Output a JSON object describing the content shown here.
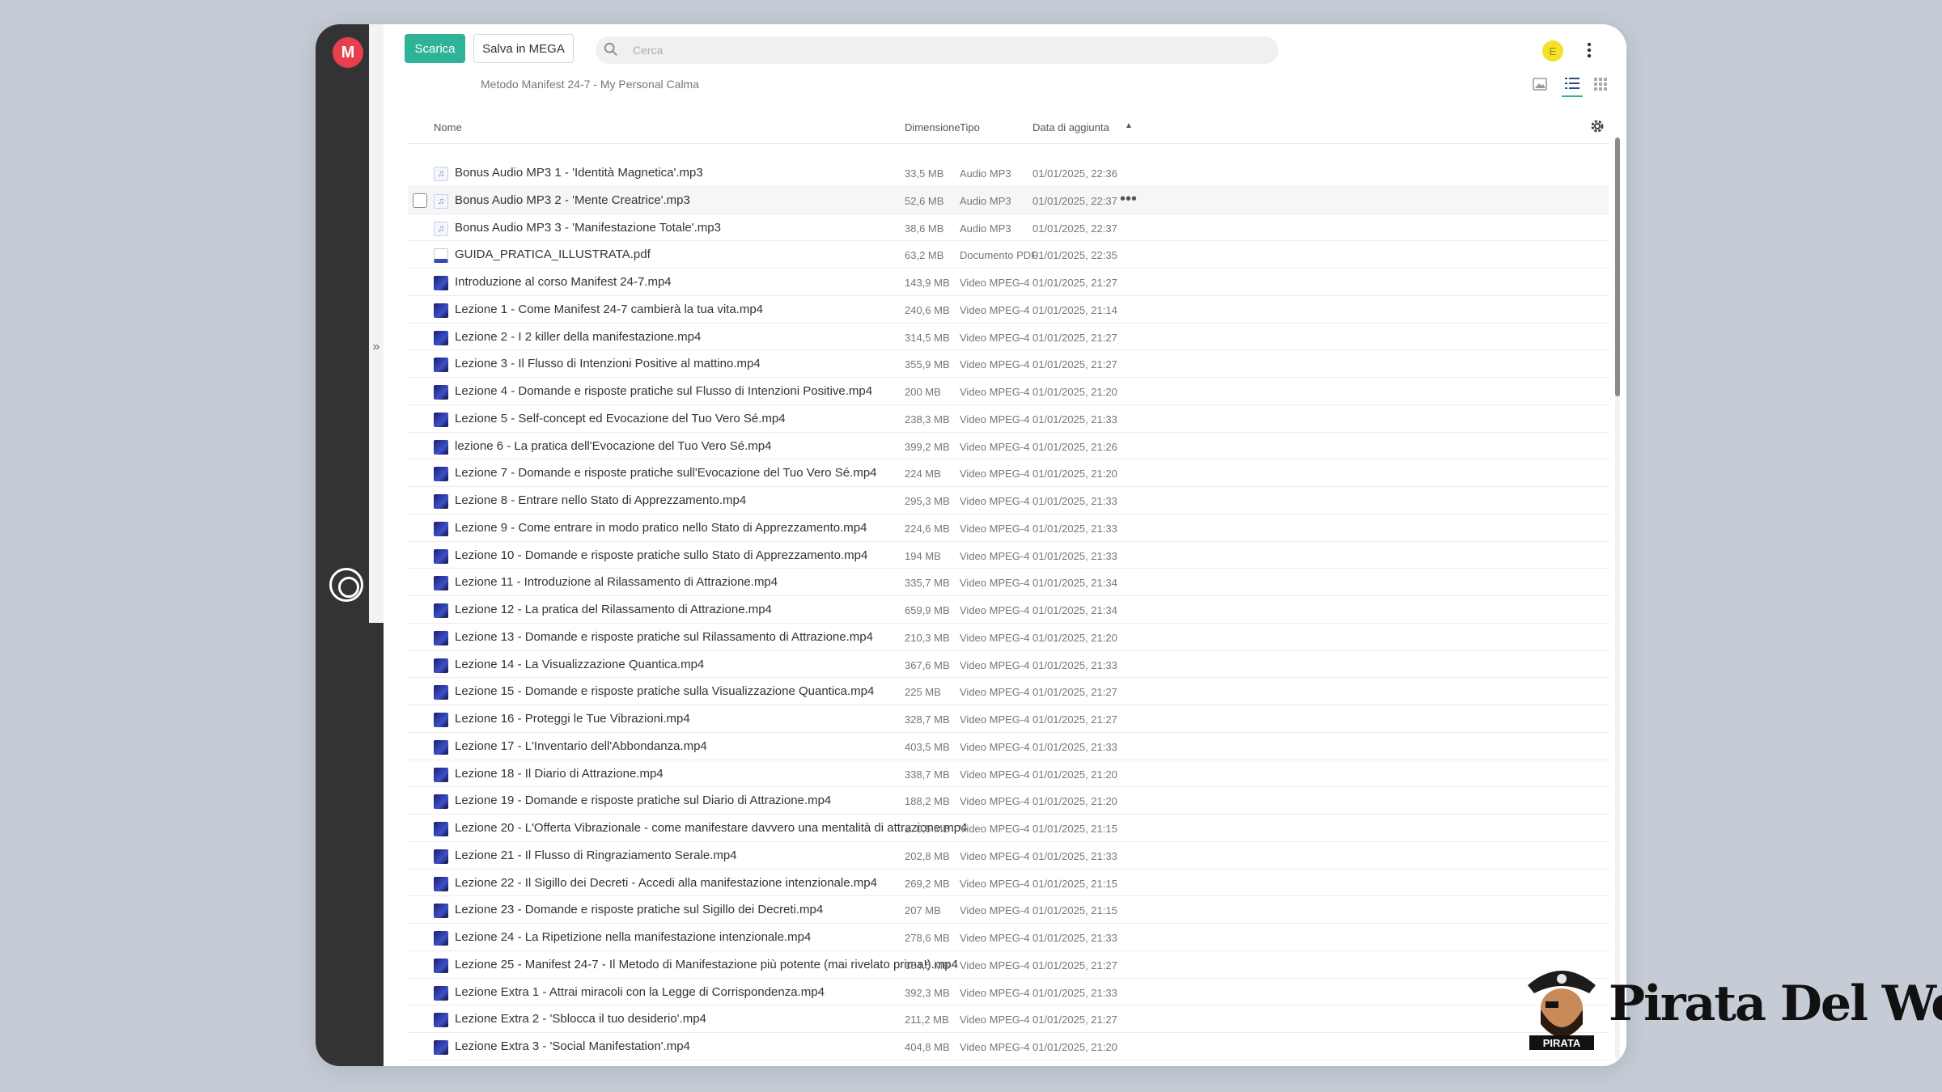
{
  "toolbar": {
    "download_label": "Scarica",
    "save_label": "Salva in MEGA",
    "search_placeholder": "Cerca",
    "avatar_letter": "E",
    "accent_color": "#2eb398"
  },
  "breadcrumb": "Metodo Manifest 24-7 - My Personal Calma",
  "columns": {
    "name": "Nome",
    "size": "Dimensione",
    "type": "Tipo",
    "date": "Data di aggiunta"
  },
  "files": [
    {
      "icon": "audio-file-icon",
      "name": "Bonus Audio MP3 1 - 'Identità Magnetica'.mp3",
      "size": "33,5 MB",
      "type": "Audio MP3",
      "date": "01/01/2025, 22:36"
    },
    {
      "icon": "audio-file-icon",
      "name": "Bonus Audio MP3 2 - 'Mente Creatrice'.mp3",
      "size": "52,6 MB",
      "type": "Audio MP3",
      "date": "01/01/2025, 22:37"
    },
    {
      "icon": "audio-file-icon",
      "name": "Bonus Audio MP3 3 - 'Manifestazione Totale'.mp3",
      "size": "38,6 MB",
      "type": "Audio MP3",
      "date": "01/01/2025, 22:37"
    },
    {
      "icon": "pdf-file-icon",
      "name": "GUIDA_PRATICA_ILLUSTRATA.pdf",
      "size": "63,2 MB",
      "type": "Documento PDF",
      "date": "01/01/2025, 22:35"
    },
    {
      "icon": "video-thumbnail-icon",
      "name": "Introduzione al corso Manifest 24-7.mp4",
      "size": "143,9 MB",
      "type": "Video MPEG-4",
      "date": "01/01/2025, 21:27"
    },
    {
      "icon": "video-thumbnail-icon",
      "name": "Lezione 1 - Come Manifest 24-7 cambierà la tua vita.mp4",
      "size": "240,6 MB",
      "type": "Video MPEG-4",
      "date": "01/01/2025, 21:14"
    },
    {
      "icon": "video-thumbnail-icon",
      "name": "Lezione 2 - I 2 killer della manifestazione.mp4",
      "size": "314,5 MB",
      "type": "Video MPEG-4",
      "date": "01/01/2025, 21:27"
    },
    {
      "icon": "video-thumbnail-icon",
      "name": "Lezione 3 - Il Flusso di Intenzioni Positive al mattino.mp4",
      "size": "355,9 MB",
      "type": "Video MPEG-4",
      "date": "01/01/2025, 21:27"
    },
    {
      "icon": "video-thumbnail-icon",
      "name": "Lezione 4 - Domande e risposte pratiche sul Flusso di Intenzioni Positive.mp4",
      "size": "200 MB",
      "type": "Video MPEG-4",
      "date": "01/01/2025, 21:20"
    },
    {
      "icon": "video-thumbnail-icon",
      "name": "Lezione 5 - Self-concept ed Evocazione del Tuo Vero Sé.mp4",
      "size": "238,3 MB",
      "type": "Video MPEG-4",
      "date": "01/01/2025, 21:33"
    },
    {
      "icon": "video-thumbnail-icon",
      "name": "lezione 6 - La pratica dell'Evocazione del Tuo Vero Sé.mp4",
      "size": "399,2 MB",
      "type": "Video MPEG-4",
      "date": "01/01/2025, 21:26"
    },
    {
      "icon": "video-thumbnail-icon",
      "name": "Lezione 7 - Domande e risposte pratiche sull'Evocazione del Tuo Vero Sé.mp4",
      "size": "224 MB",
      "type": "Video MPEG-4",
      "date": "01/01/2025, 21:20"
    },
    {
      "icon": "video-thumbnail-icon",
      "name": "Lezione 8 - Entrare nello Stato di Apprezzamento.mp4",
      "size": "295,3 MB",
      "type": "Video MPEG-4",
      "date": "01/01/2025, 21:33"
    },
    {
      "icon": "video-thumbnail-icon",
      "name": "Lezione 9 - Come entrare in modo pratico nello Stato di Apprezzamento.mp4",
      "size": "224,6 MB",
      "type": "Video MPEG-4",
      "date": "01/01/2025, 21:33"
    },
    {
      "icon": "video-thumbnail-icon",
      "name": "Lezione 10 - Domande e risposte pratiche sullo Stato di Apprezzamento.mp4",
      "size": "194 MB",
      "type": "Video MPEG-4",
      "date": "01/01/2025, 21:33"
    },
    {
      "icon": "video-thumbnail-icon",
      "name": "Lezione 11 - Introduzione al Rilassamento di Attrazione.mp4",
      "size": "335,7 MB",
      "type": "Video MPEG-4",
      "date": "01/01/2025, 21:34"
    },
    {
      "icon": "video-thumbnail-icon",
      "name": "Lezione 12 - La pratica del Rilassamento di Attrazione.mp4",
      "size": "659,9 MB",
      "type": "Video MPEG-4",
      "date": "01/01/2025, 21:34"
    },
    {
      "icon": "video-thumbnail-icon",
      "name": "Lezione 13 - Domande e risposte pratiche sul Rilassamento di Attrazione.mp4",
      "size": "210,3 MB",
      "type": "Video MPEG-4",
      "date": "01/01/2025, 21:20"
    },
    {
      "icon": "video-thumbnail-icon",
      "name": "Lezione 14 - La Visualizzazione Quantica.mp4",
      "size": "367,6 MB",
      "type": "Video MPEG-4",
      "date": "01/01/2025, 21:33"
    },
    {
      "icon": "video-thumbnail-icon",
      "name": "Lezione 15 - Domande e risposte pratiche sulla Visualizzazione Quantica.mp4",
      "size": "225 MB",
      "type": "Video MPEG-4",
      "date": "01/01/2025, 21:27"
    },
    {
      "icon": "video-thumbnail-icon",
      "name": "Lezione 16 - Proteggi le Tue Vibrazioni.mp4",
      "size": "328,7 MB",
      "type": "Video MPEG-4",
      "date": "01/01/2025, 21:27"
    },
    {
      "icon": "video-thumbnail-icon",
      "name": "Lezione 17 - L'Inventario dell'Abbondanza.mp4",
      "size": "403,5 MB",
      "type": "Video MPEG-4",
      "date": "01/01/2025, 21:33"
    },
    {
      "icon": "video-thumbnail-icon",
      "name": "Lezione 18 - Il Diario di Attrazione.mp4",
      "size": "338,7 MB",
      "type": "Video MPEG-4",
      "date": "01/01/2025, 21:20"
    },
    {
      "icon": "video-thumbnail-icon",
      "name": "Lezione 19 - Domande e risposte pratiche sul Diario di Attrazione.mp4",
      "size": "188,2 MB",
      "type": "Video MPEG-4",
      "date": "01/01/2025, 21:20"
    },
    {
      "icon": "video-thumbnail-icon",
      "name": "Lezione 20 - L'Offerta Vibrazionale - come manifestare davvero una mentalità di attrazione.mp4",
      "size": "270,5 MB",
      "type": "Video MPEG-4",
      "date": "01/01/2025, 21:15"
    },
    {
      "icon": "video-thumbnail-icon",
      "name": "Lezione 21 - Il Flusso di Ringraziamento Serale.mp4",
      "size": "202,8 MB",
      "type": "Video MPEG-4",
      "date": "01/01/2025, 21:33"
    },
    {
      "icon": "video-thumbnail-icon",
      "name": "Lezione 22 - Il Sigillo dei Decreti - Accedi alla manifestazione intenzionale.mp4",
      "size": "269,2 MB",
      "type": "Video MPEG-4",
      "date": "01/01/2025, 21:15"
    },
    {
      "icon": "video-thumbnail-icon",
      "name": "Lezione 23 - Domande e risposte pratiche sul Sigillo dei Decreti.mp4",
      "size": "207 MB",
      "type": "Video MPEG-4",
      "date": "01/01/2025, 21:15"
    },
    {
      "icon": "video-thumbnail-icon",
      "name": "Lezione 24 - La Ripetizione nella manifestazione intenzionale.mp4",
      "size": "278,6 MB",
      "type": "Video MPEG-4",
      "date": "01/01/2025, 21:33"
    },
    {
      "icon": "video-thumbnail-icon",
      "name": "Lezione 25 - Manifest 24-7 - Il Metodo di Manifestazione più potente (mai rivelato prima!).mp4",
      "size": "384,5 MB",
      "type": "Video MPEG-4",
      "date": "01/01/2025, 21:27"
    },
    {
      "icon": "video-thumbnail-icon",
      "name": "Lezione Extra 1 - Attrai miracoli con la Legge di Corrispondenza.mp4",
      "size": "392,3 MB",
      "type": "Video MPEG-4",
      "date": "01/01/2025, 21:33"
    },
    {
      "icon": "video-thumbnail-icon",
      "name": "Lezione Extra 2 - 'Sblocca il tuo desiderio'.mp4",
      "size": "211,2 MB",
      "type": "Video MPEG-4",
      "date": "01/01/2025, 21:27"
    },
    {
      "icon": "video-thumbnail-icon",
      "name": "Lezione Extra 3 - 'Social Manifestation'.mp4",
      "size": "404,8 MB",
      "type": "Video MPEG-4",
      "date": "01/01/2025, 21:20"
    }
  ],
  "hovered_row_index": 1,
  "watermark": {
    "badge_text": "PIRATA",
    "brand_text": "Pirata Del Web"
  }
}
